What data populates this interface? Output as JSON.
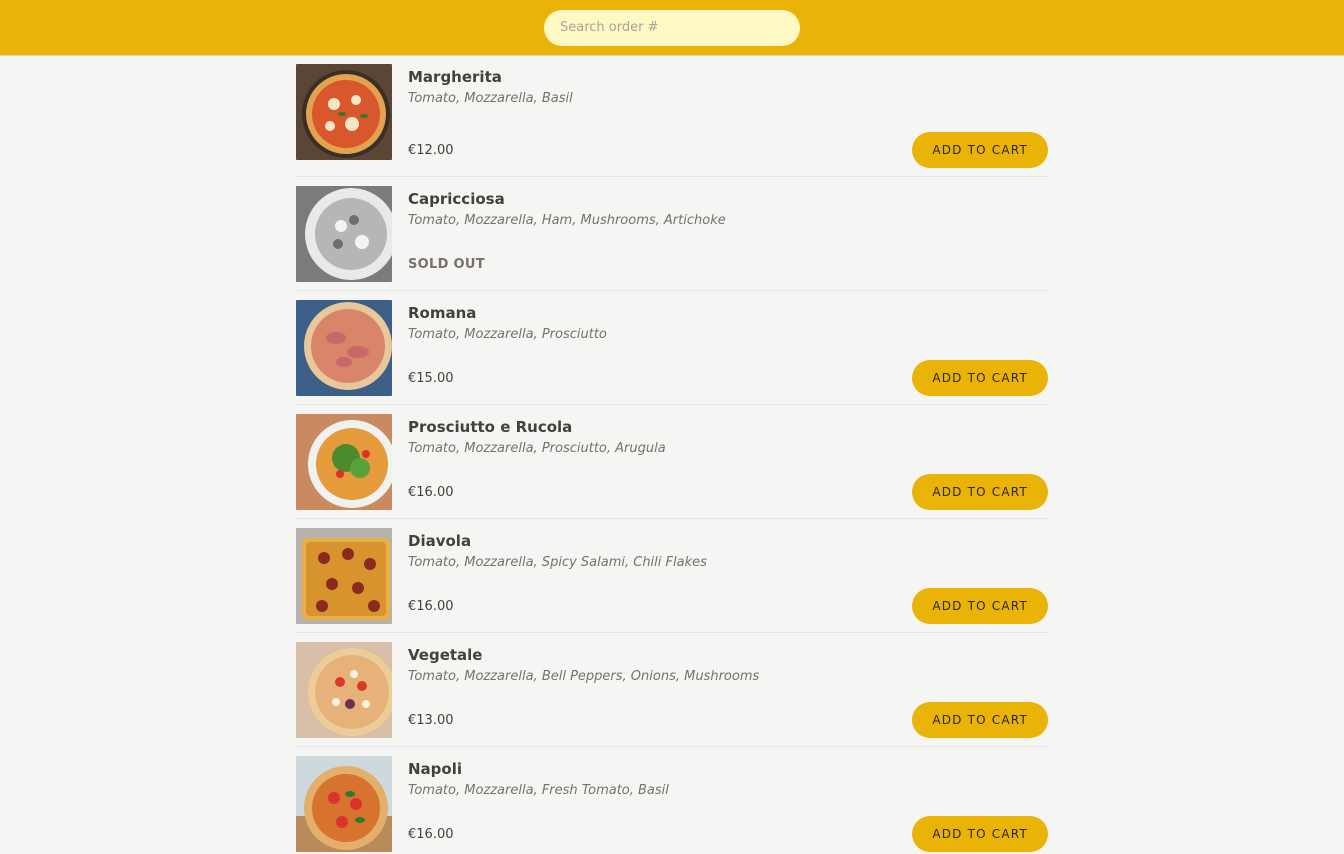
{
  "header": {
    "search_placeholder": "Search order #"
  },
  "menu": [
    {
      "name": "Margherita",
      "ingredients": "Tomato, Mozzarella, Basil",
      "price": "€12.00",
      "sold_out": false,
      "button": "ADD TO CART"
    },
    {
      "name": "Capricciosa",
      "ingredients": "Tomato, Mozzarella, Ham, Mushrooms, Artichoke",
      "status": "SOLD OUT",
      "sold_out": true
    },
    {
      "name": "Romana",
      "ingredients": "Tomato, Mozzarella, Prosciutto",
      "price": "€15.00",
      "sold_out": false,
      "button": "ADD TO CART"
    },
    {
      "name": "Prosciutto e Rucola",
      "ingredients": "Tomato, Mozzarella, Prosciutto, Arugula",
      "price": "€16.00",
      "sold_out": false,
      "button": "ADD TO CART"
    },
    {
      "name": "Diavola",
      "ingredients": "Tomato, Mozzarella, Spicy Salami, Chili Flakes",
      "price": "€16.00",
      "sold_out": false,
      "button": "ADD TO CART"
    },
    {
      "name": "Vegetale",
      "ingredients": "Tomato, Mozzarella, Bell Peppers, Onions, Mushrooms",
      "price": "€13.00",
      "sold_out": false,
      "button": "ADD TO CART"
    },
    {
      "name": "Napoli",
      "ingredients": "Tomato, Mozzarella, Fresh Tomato, Basil",
      "price": "€16.00",
      "sold_out": false,
      "button": "ADD TO CART"
    }
  ],
  "colors": {
    "accent": "#eab308",
    "search_bg": "#fef9c3",
    "background": "#f5f5f4"
  }
}
